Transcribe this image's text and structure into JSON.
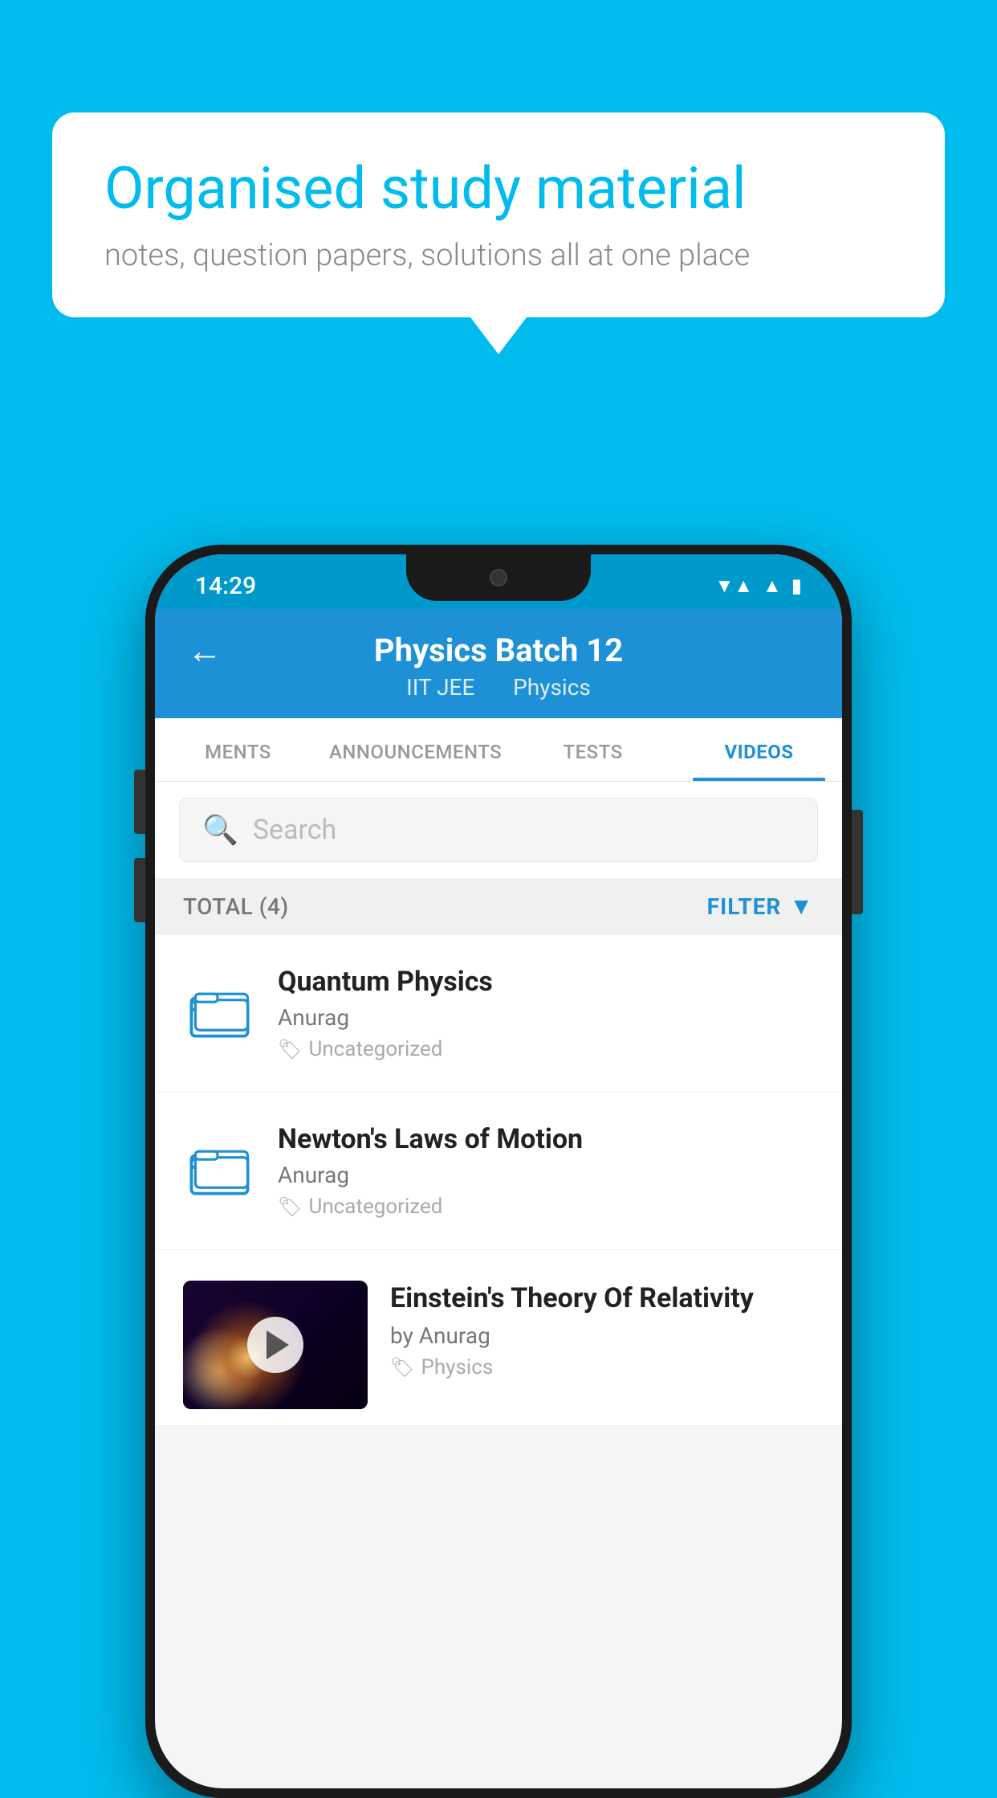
{
  "background": {
    "color": "#00BCEE"
  },
  "speechBubble": {
    "title": "Organised study material",
    "subtitle": "notes, question papers, solutions all at one place"
  },
  "statusBar": {
    "time": "14:29",
    "icons": [
      "wifi",
      "signal",
      "battery"
    ]
  },
  "header": {
    "backLabel": "←",
    "title": "Physics Batch 12",
    "subtitle1": "IIT JEE",
    "subtitle2": "Physics"
  },
  "tabs": [
    {
      "label": "MENTS",
      "active": false
    },
    {
      "label": "ANNOUNCEMENTS",
      "active": false
    },
    {
      "label": "TESTS",
      "active": false
    },
    {
      "label": "VIDEOS",
      "active": true
    }
  ],
  "search": {
    "placeholder": "Search"
  },
  "filterBar": {
    "totalLabel": "TOTAL (4)",
    "filterLabel": "FILTER"
  },
  "videoItems": [
    {
      "id": 1,
      "title": "Quantum Physics",
      "author": "Anurag",
      "tag": "Uncategorized",
      "hasThumbnail": false
    },
    {
      "id": 2,
      "title": "Newton's Laws of Motion",
      "author": "Anurag",
      "tag": "Uncategorized",
      "hasThumbnail": false
    },
    {
      "id": 3,
      "title": "Einstein's Theory Of Relativity",
      "author": "by Anurag",
      "tag": "Physics",
      "hasThumbnail": true
    }
  ]
}
